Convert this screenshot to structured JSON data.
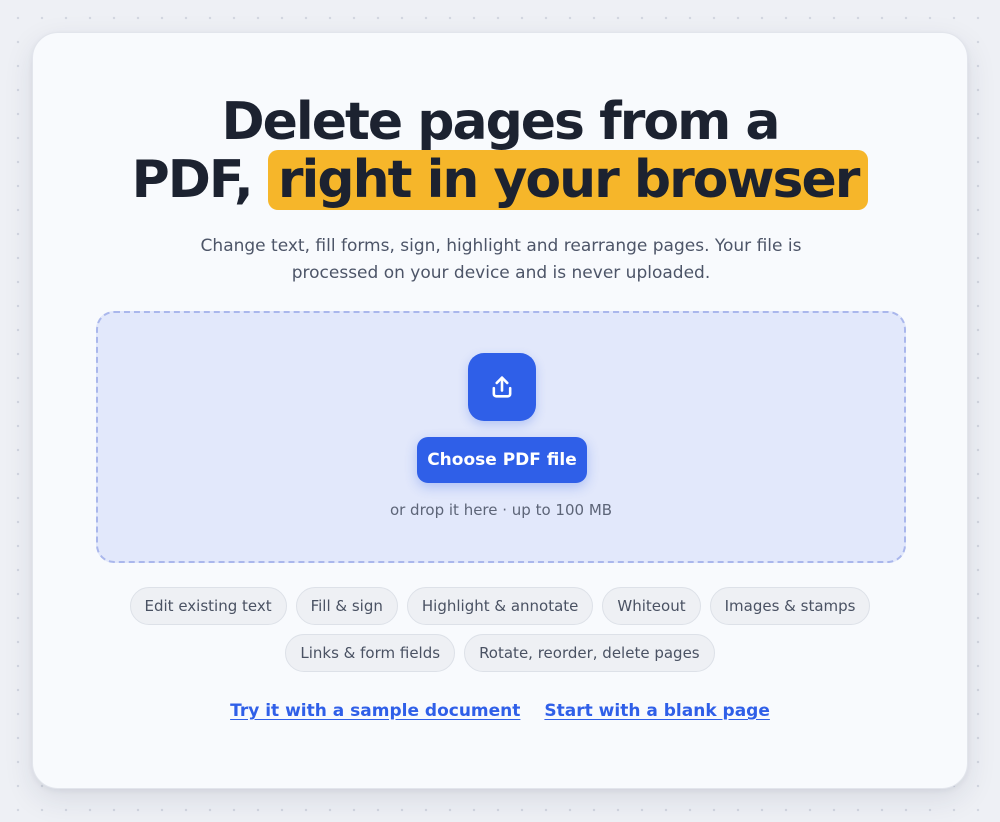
{
  "hero": {
    "title_line1": "Delete pages from a",
    "title_line2_prefix": "PDF, ",
    "title_line2_highlight": "right in your browser",
    "subtitle": "Change text, fill forms, sign, highlight and rearrange pages. Your file is processed on your device and is never uploaded."
  },
  "dropzone": {
    "icon": "upload-icon",
    "button_label": "Choose PDF file",
    "hint": "or drop it here · up to 100 MB"
  },
  "features": {
    "row1": [
      "Edit existing text",
      "Fill & sign",
      "Highlight & annotate",
      "Whiteout",
      "Images & stamps"
    ],
    "row2": [
      "Links & form fields",
      "Rotate, reorder, delete pages"
    ]
  },
  "links": {
    "sample": "Try it with a sample document",
    "blank": "Start with a blank page"
  },
  "colors": {
    "accent": "#2f5fe8",
    "highlight": "#f6b62a",
    "heading": "#1c2230",
    "dropzone_bg": "#e2e8fb"
  }
}
